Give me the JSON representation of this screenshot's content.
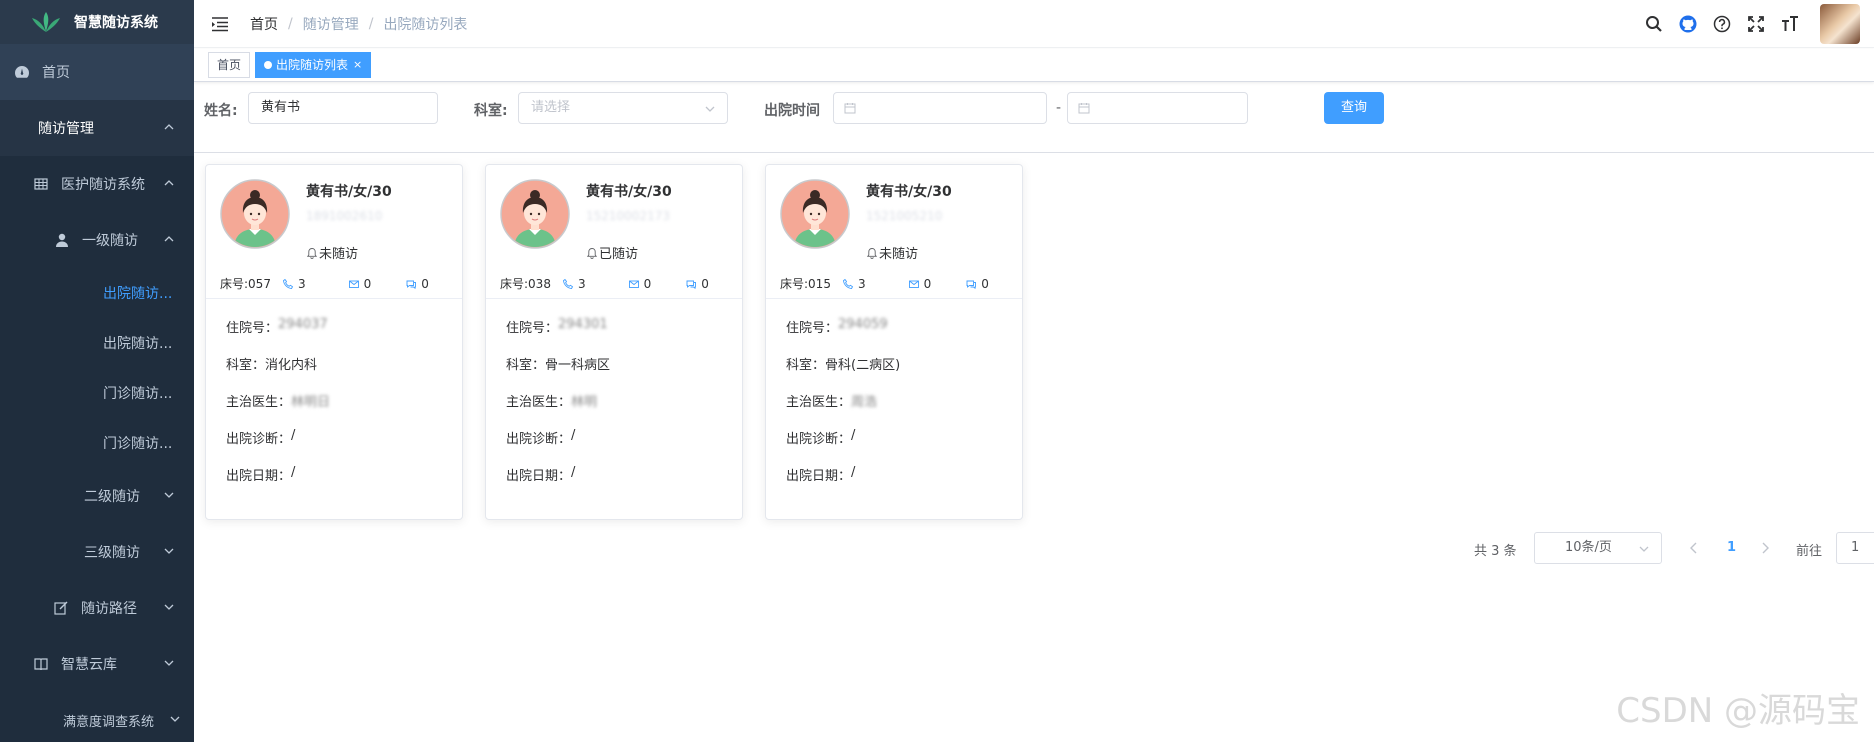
{
  "app": {
    "title": "智慧随访系统"
  },
  "sidebar": {
    "items": [
      {
        "label": "首页",
        "icon": "dashboard-icon"
      },
      {
        "label": "随访管理"
      },
      {
        "label": "医护随访系统",
        "icon": "grid-icon"
      },
      {
        "label": "一级随访",
        "icon": "user-icon"
      },
      {
        "label": "出院随访..."
      },
      {
        "label": "出院随访..."
      },
      {
        "label": "门诊随访..."
      },
      {
        "label": "门诊随访..."
      },
      {
        "label": "二级随访"
      },
      {
        "label": "三级随访"
      },
      {
        "label": "随访路径",
        "icon": "edit-icon"
      },
      {
        "label": "智慧云库",
        "icon": "book-icon"
      },
      {
        "label": "满意度调查系统"
      }
    ]
  },
  "breadcrumb": {
    "home": "首页",
    "sep": "/",
    "mid": "随访管理",
    "current": "出院随访列表"
  },
  "tags": {
    "home": "首页",
    "active": "出院随访列表",
    "close": "×"
  },
  "filter": {
    "name_label": "姓名:",
    "name_value": "黄有书",
    "dept_label": "科室:",
    "dept_placeholder": "请选择",
    "date_label": "出院时间",
    "date_sep": "-",
    "query_button": "查询"
  },
  "cards": [
    {
      "name": "黄有书/女/30",
      "phone": "1891002610",
      "status": "未随访",
      "bed": "床号:057",
      "calls": "3",
      "mails": "0",
      "chats": "0",
      "admission_label": "住院号：",
      "admission_value": "294037",
      "dept_label": "科室：",
      "dept_value": "消化内科",
      "doctor_label": "主治医生：",
      "doctor_value": "林明日",
      "diag_label": "出院诊断：",
      "diag_value": "/",
      "date_label": "出院日期：",
      "date_value": "/"
    },
    {
      "name": "黄有书/女/30",
      "phone": "15210002173",
      "status": "已随访",
      "bed": "床号:038",
      "calls": "3",
      "mails": "0",
      "chats": "0",
      "admission_label": "住院号：",
      "admission_value": "294301",
      "dept_label": "科室：",
      "dept_value": "骨一科病区",
      "doctor_label": "主治医生：",
      "doctor_value": "林明",
      "diag_label": "出院诊断：",
      "diag_value": "/",
      "date_label": "出院日期：",
      "date_value": "/"
    },
    {
      "name": "黄有书/女/30",
      "phone": "1521005210",
      "status": "未随访",
      "bed": "床号:015",
      "calls": "3",
      "mails": "0",
      "chats": "0",
      "admission_label": "住院号：",
      "admission_value": "294059",
      "dept_label": "科室：",
      "dept_value": "骨科(二病区)",
      "doctor_label": "主治医生：",
      "doctor_value": "周浩",
      "diag_label": "出院诊断：",
      "diag_value": "/",
      "date_label": "出院日期：",
      "date_value": "/"
    }
  ],
  "pagination": {
    "total": "共 3 条",
    "page_size": "10条/页",
    "page": "1",
    "goto_label": "前往",
    "goto_value": "1"
  },
  "watermark": "CSDN @源码宝",
  "colors": {
    "sidebar_bg": "#304156",
    "accent": "#409eff"
  }
}
